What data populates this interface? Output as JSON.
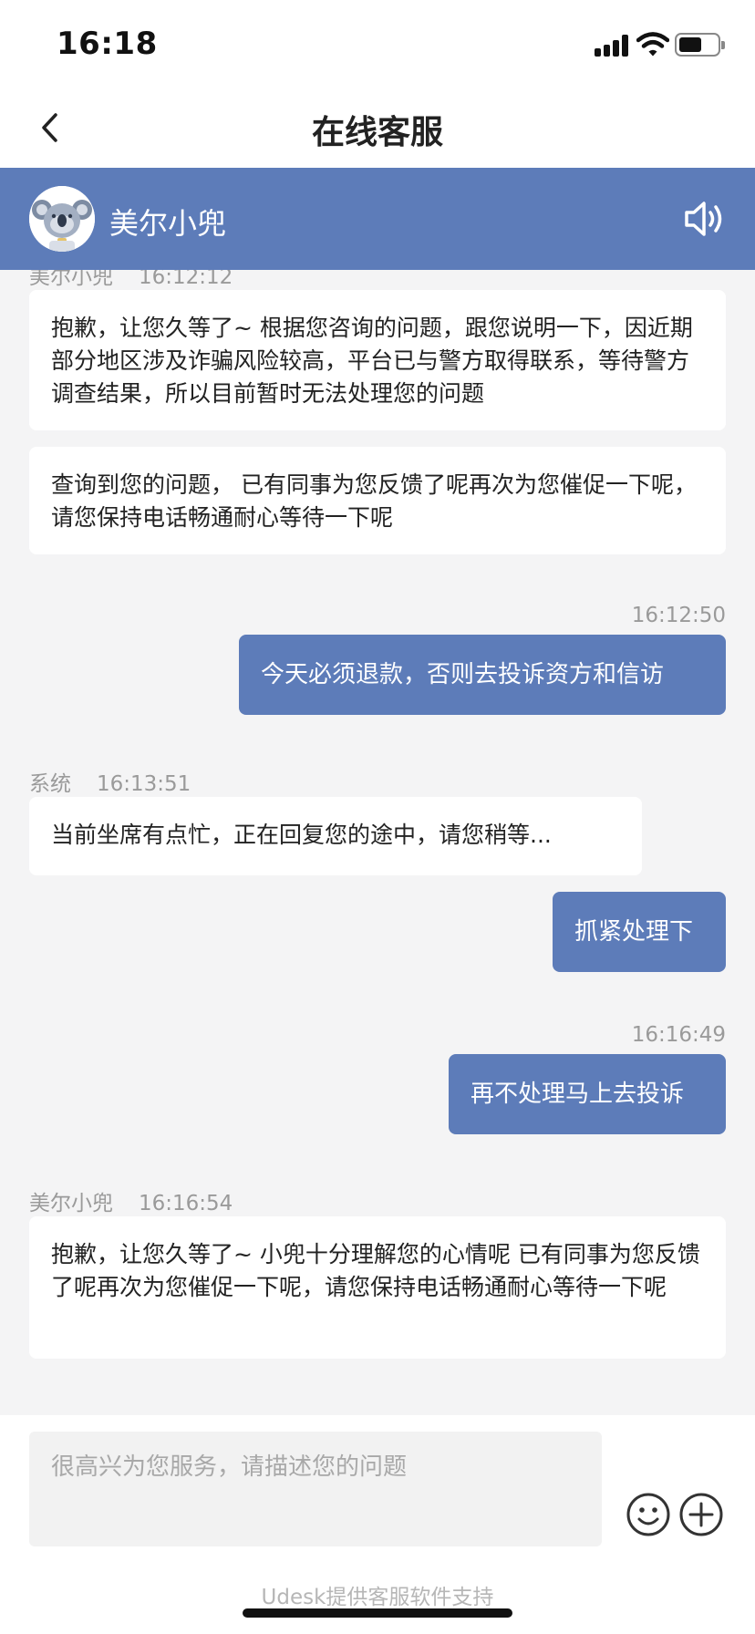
{
  "status_bar": {
    "time": "16:18"
  },
  "nav": {
    "title": "在线客服"
  },
  "agent": {
    "name": "美尔小兜"
  },
  "messages": [
    {
      "sender": "美尔小兜",
      "time": "16:12:12",
      "text": "抱歉，让您久等了~ 根据您咨询的问题，跟您说明一下，因近期部分地区涉及诈骗风险较高，平台已与警方取得联系，等待警方调查结果，所以目前暂时无法处理您的问题"
    },
    {
      "text": "查询到您的问题， 已有同事为您反馈了呢再次为您催促一下呢，请您保持电话畅通耐心等待一下呢"
    },
    {
      "time": "16:12:50",
      "text": "今天必须退款，否则去投诉资方和信访"
    },
    {
      "sender": "系统",
      "time": "16:13:51",
      "text": "当前坐席有点忙，正在回复您的途中，请您稍等..."
    },
    {
      "text": "抓紧处理下"
    },
    {
      "time": "16:16:49",
      "text": "再不处理马上去投诉"
    },
    {
      "sender": "美尔小兜",
      "time": "16:16:54",
      "text": "抱歉，让您久等了~ 小兜十分理解您的心情呢 已有同事为您反馈了呢再次为您催促一下呢，请您保持电话畅通耐心等待一下呢"
    }
  ],
  "input": {
    "placeholder": "很高兴为您服务，请描述您的问题",
    "value": ""
  },
  "footer": {
    "note": "Udesk提供客服软件支持"
  },
  "icons": {
    "back": "chevron-left-icon",
    "speaker": "speaker-icon",
    "emoji": "smiley-icon",
    "plus": "plus-circle-icon",
    "avatar": "koala-avatar"
  },
  "colors": {
    "accent": "#5d7cb9",
    "background": "#f4f4f5",
    "bubble_agent": "#ffffff",
    "meta_text": "#9a9a9a"
  }
}
